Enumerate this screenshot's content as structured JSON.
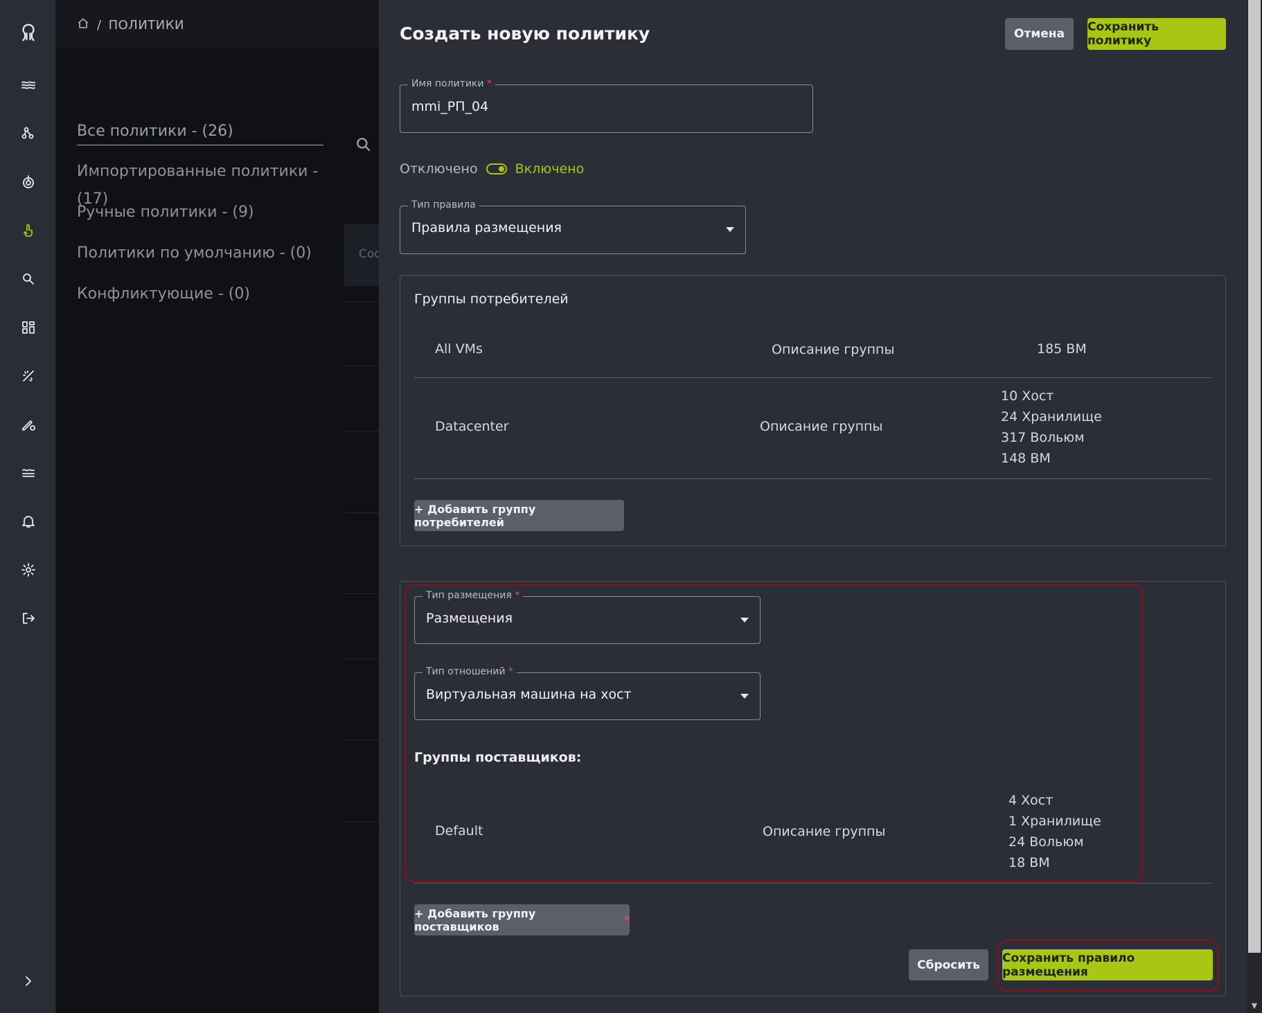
{
  "breadcrumb": {
    "page": "ПОЛИТИКИ"
  },
  "filters": [
    {
      "label": "Все политики - (26)"
    },
    {
      "label": "Импортированные политики - (17)"
    },
    {
      "label": "Ручные политики - (9)"
    },
    {
      "label": "Политики по умолчанию - (0)"
    },
    {
      "label": "Конфликтующие - (0)"
    }
  ],
  "background_table": {
    "partial_header": "Coo"
  },
  "drawer": {
    "title": "Создать новую политику",
    "cancel_label": "Отмена",
    "save_policy_label": "Сохранить политику",
    "policy_name": {
      "label": "Имя политики",
      "required_mark": "*",
      "value": "mmi_РП_04"
    },
    "toggle": {
      "off_label": "Отключено",
      "on_label": "Включено",
      "state": "on"
    },
    "rule_type": {
      "label": "Тип правила",
      "value": "Правила размещения"
    },
    "consumers": {
      "title": "Группы потребителей",
      "rows": [
        {
          "name": "All VMs",
          "description": "Описание группы",
          "counts": [
            "185 ВМ"
          ]
        },
        {
          "name": "Datacenter",
          "description": "Описание группы",
          "counts": [
            "10 Хост",
            "24 Хранилище",
            "317 Вольюм",
            "148 ВМ"
          ]
        }
      ],
      "add_label": "+ Добавить группу потребителей"
    },
    "placement": {
      "placement_type": {
        "label": "Тип размещения",
        "required_mark": "*",
        "value": "Размещения"
      },
      "relation_type": {
        "label": "Тип отношений",
        "required_mark": "*",
        "value": "Виртуальная машина на хост"
      },
      "providers_title": "Группы поставщиков:",
      "providers": [
        {
          "name": "Default",
          "description": "Описание группы",
          "counts": [
            "4 Хост",
            "1 Хранилище",
            "24 Вольюм",
            "18 ВМ"
          ]
        }
      ],
      "add_provider_label": "+ Добавить группу поставщиков",
      "add_provider_required": "*",
      "reset_label": "Сбросить",
      "save_rule_label": "Сохранить правило размещения"
    }
  },
  "colors": {
    "accent": "#a8c614",
    "highlight": "#8b0f1f",
    "drawer_bg": "#2b2e36",
    "rail_bg": "#2a2d35"
  },
  "rail_icons": [
    "octopus-logo-icon",
    "waves-icon",
    "nodes-icon",
    "power-icon",
    "touch-icon",
    "search-icon",
    "dashboard-icon",
    "magic-icon",
    "edit-settings-icon",
    "levels-icon",
    "bell-icon",
    "gear-icon",
    "logout-icon",
    "chevron-right-icon"
  ]
}
